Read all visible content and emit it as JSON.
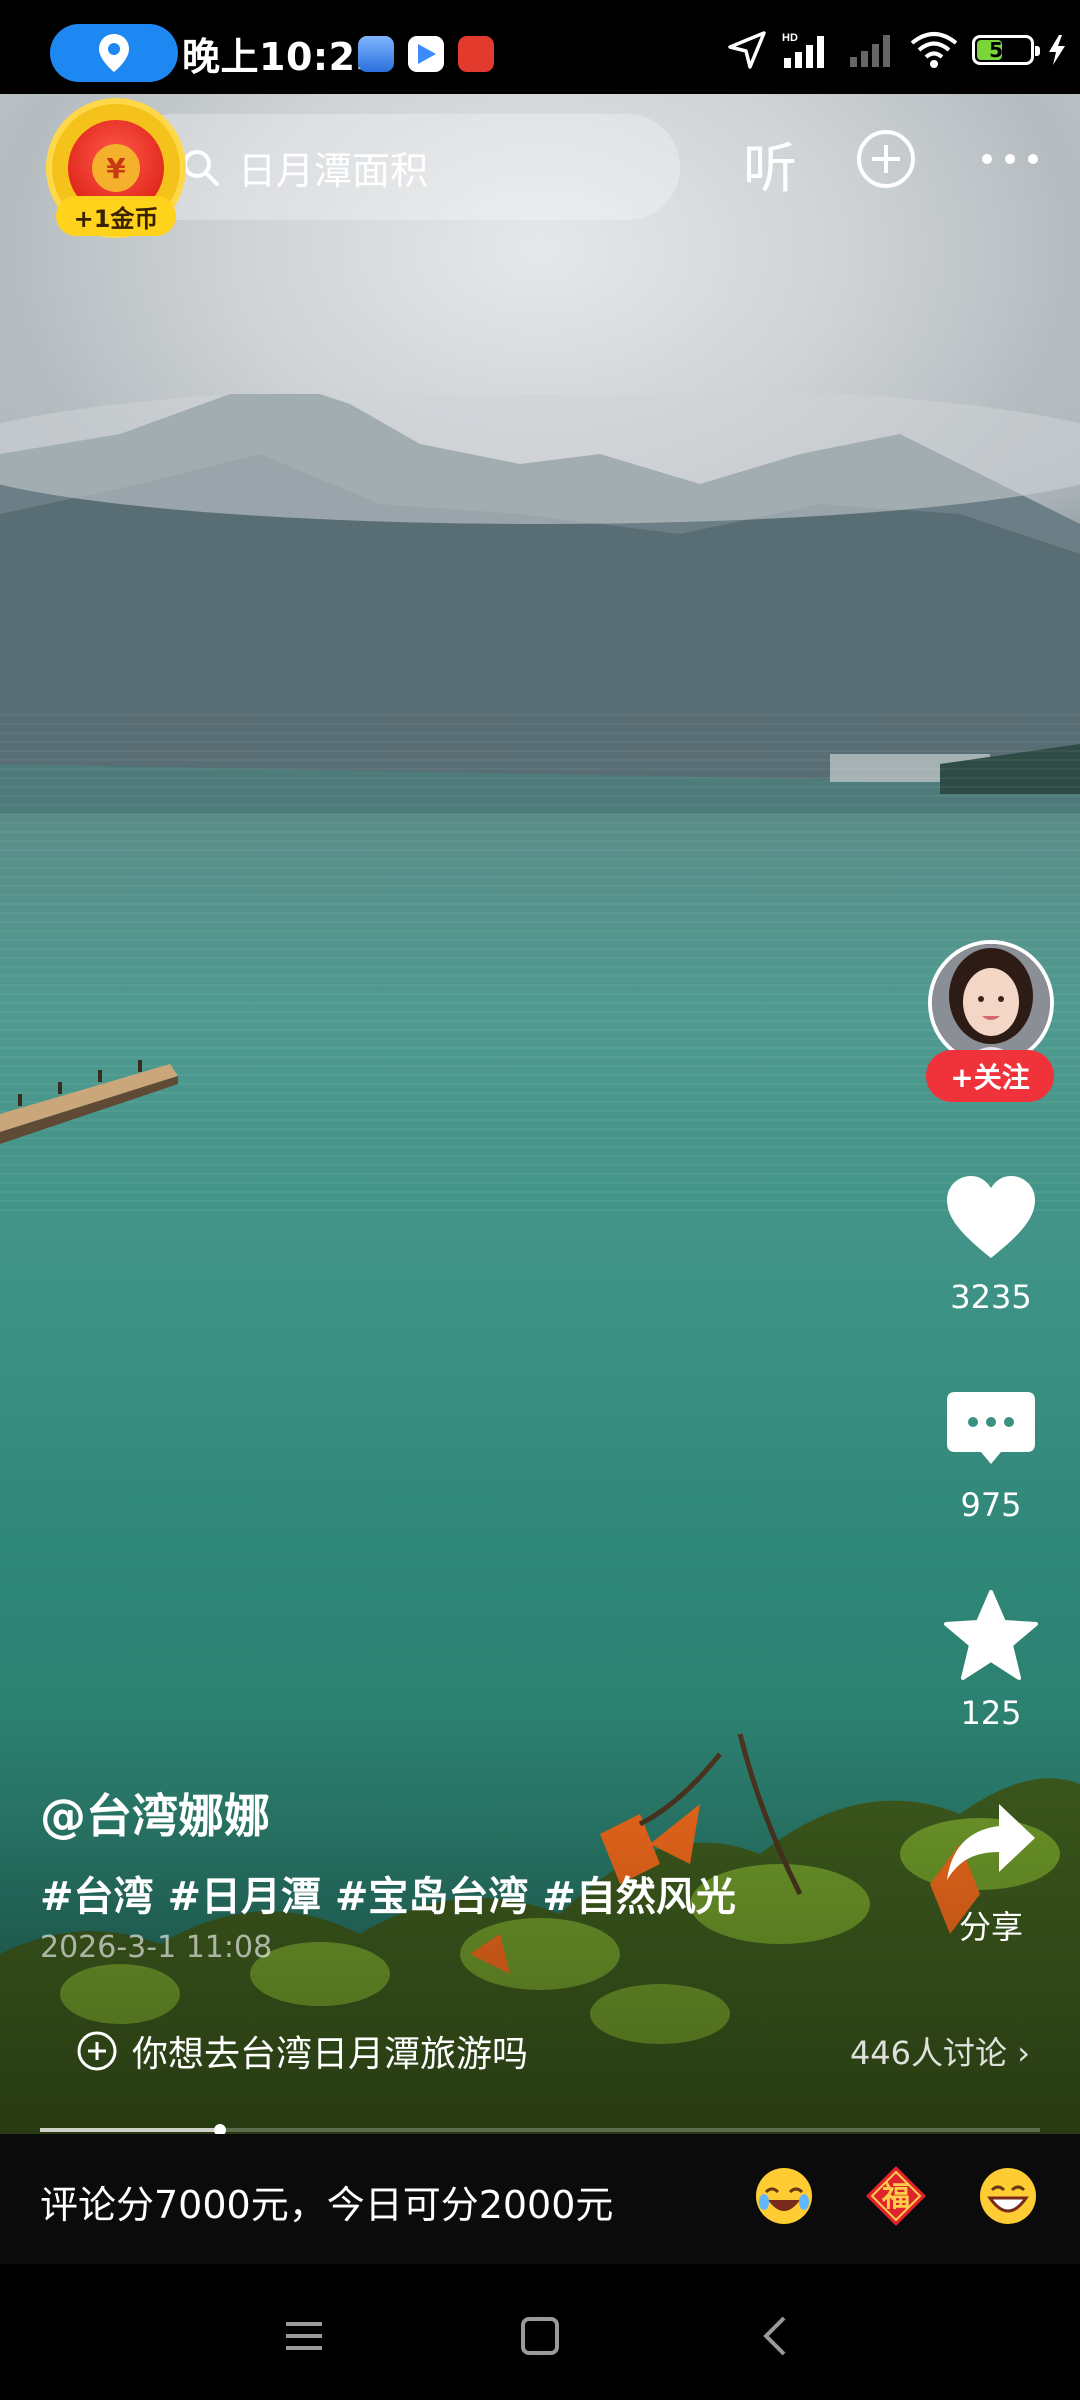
{
  "status_bar": {
    "time": "晚上10:25",
    "battery": "51",
    "battery_level": 0.51
  },
  "top_bar": {
    "coin_label": "+1金币",
    "search_query": "日月潭面积",
    "listen_label": "听"
  },
  "creator": {
    "follow_label": "+关注"
  },
  "actions": {
    "likes": "3235",
    "comments": "975",
    "favorites": "125",
    "share_label": "分享"
  },
  "post": {
    "author": "@台湾娜娜",
    "tags": "#台湾 #日月潭 #宝岛台湾 #自然风光",
    "date": "2026-3-1 11:08",
    "topic": "你想去台湾日月潭旅游吗",
    "topic_count": "446人讨论 ›",
    "progress": 0.18
  },
  "comment_bar": {
    "placeholder": "评论分7000元，今日可分2000元"
  },
  "colors": {
    "follow_red": "#f0323b",
    "coin_gold": "#f5c21b",
    "location_blue": "#1e88f2",
    "battery_green": "#7bd43a"
  },
  "icons": [
    "location-icon",
    "search-icon",
    "add-icon",
    "more-icon",
    "heart-icon",
    "comment-icon",
    "star-icon",
    "share-icon",
    "topic-plus-icon",
    "laugh-emoji-icon",
    "fu-emoji-icon",
    "grin-emoji-icon",
    "menu-icon",
    "home-icon",
    "back-icon"
  ]
}
